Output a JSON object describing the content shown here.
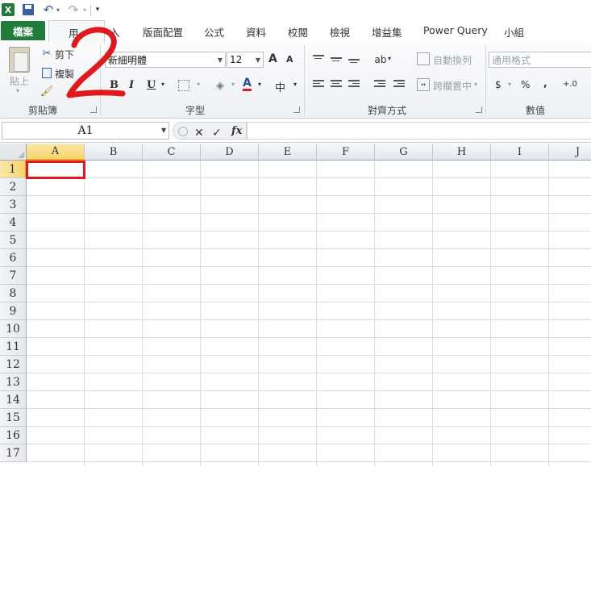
{
  "qat": {
    "logo_letter": "X",
    "undo_glyph": "↶",
    "redo_glyph": "↷",
    "dropdown_glyph": "▾",
    "customize_glyph": "▾"
  },
  "tabs": [
    {
      "id": "insert",
      "label": "插入",
      "visible": "入"
    },
    {
      "id": "layout",
      "label": "版面配置"
    },
    {
      "id": "formulas",
      "label": "公式"
    },
    {
      "id": "data",
      "label": "資料"
    },
    {
      "id": "review",
      "label": "校閱"
    },
    {
      "id": "view",
      "label": "檢視"
    },
    {
      "id": "addins",
      "label": "增益集"
    },
    {
      "id": "powerquery",
      "label": "Power Query"
    },
    {
      "id": "team",
      "label": "小組"
    }
  ],
  "file_tab": "檔案",
  "home_tab_visible": "用",
  "clipboard": {
    "paste": "貼上",
    "cut": "剪下",
    "copy": "複製",
    "group": "剪貼簿"
  },
  "font": {
    "name": "新細明體",
    "size": "12",
    "grow": "A",
    "shrink": "A",
    "bold": "B",
    "italic": "I",
    "underline": "U",
    "font_color_letter": "A",
    "phonetic": "中",
    "group": "字型"
  },
  "alignment": {
    "wrap": "自動換列",
    "merge": "跨欄置中",
    "group": "對齊方式"
  },
  "number": {
    "format": "通用格式",
    "currency": "$",
    "percent": "%",
    "comma": ",",
    "inc_decimal": "+.0",
    "group": "數值"
  },
  "formula_bar": {
    "name_box": "A1",
    "cancel": "✕",
    "enter": "✓",
    "fx": "fx"
  },
  "grid": {
    "columns": [
      "A",
      "B",
      "C",
      "D",
      "E",
      "F",
      "G",
      "H",
      "I",
      "J"
    ],
    "rows": [
      "1",
      "2",
      "3",
      "4",
      "5",
      "6",
      "7",
      "8",
      "9",
      "10",
      "11",
      "12",
      "13",
      "14",
      "15",
      "16",
      "17"
    ],
    "selected_column": "A",
    "selected_row": "1"
  },
  "colors": {
    "file_tab": "#1f7c3b",
    "annotation": "#e0191f",
    "selected_header": "#f6d36c"
  }
}
